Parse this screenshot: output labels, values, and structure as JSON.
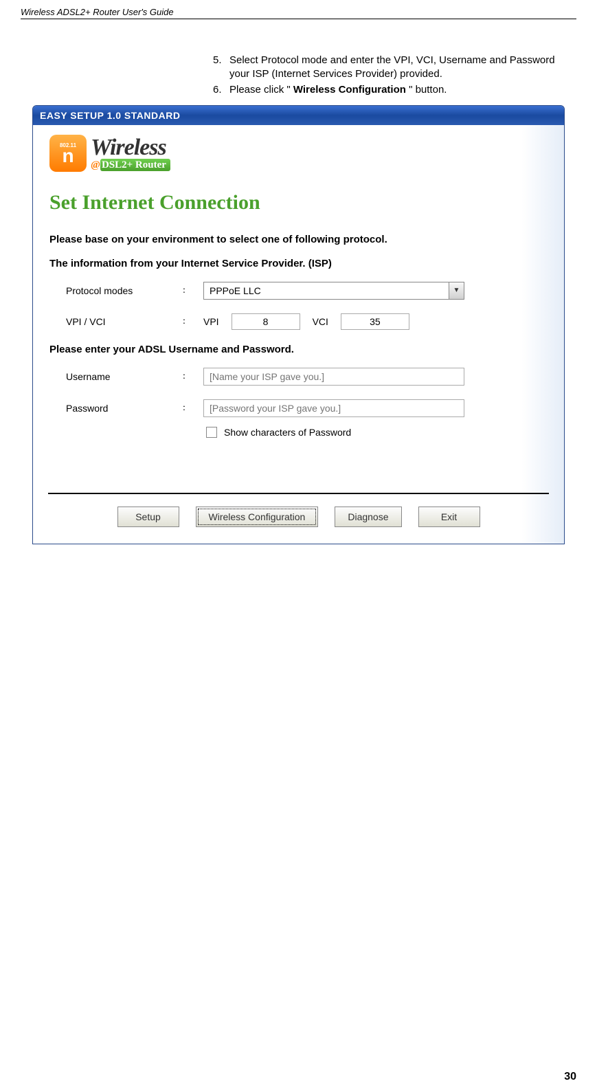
{
  "header": "Wireless ADSL2+ Router User's Guide",
  "instructions": [
    {
      "num": "5.",
      "before": "Select Protocol mode and enter the VPI, VCI, Username and Password your ISP (Internet Services Provider) provided.",
      "bold": "",
      "after": ""
    },
    {
      "num": "6.",
      "before": "Please click \" ",
      "bold": "Wireless Configuration",
      "after": " \" button."
    }
  ],
  "window": {
    "title": "EASY SETUP 1.0 STANDARD",
    "logo": {
      "badge_top": "802.11",
      "badge_letter": "n",
      "wireless": "Wireless",
      "sub_at": "@",
      "sub_rest": "DSL2+ Router"
    },
    "heading": "Set Internet Connection",
    "sub1": "Please base on your environment to select one of following protocol.",
    "sub2": "The information from your Internet Service Provider. (ISP)",
    "protocol": {
      "label": "Protocol modes",
      "value": "PPPoE LLC"
    },
    "vpivci": {
      "label": "VPI / VCI",
      "vpi_label": "VPI",
      "vpi_value": "8",
      "vci_label": "VCI",
      "vci_value": "35"
    },
    "sub3": "Please enter your ADSL Username and Password.",
    "username": {
      "label": "Username",
      "placeholder": "[Name your ISP gave you.]"
    },
    "password": {
      "label": "Password",
      "placeholder": "[Password your ISP gave you.]"
    },
    "showpw": "Show characters of Password",
    "buttons": {
      "setup": "Setup",
      "wireless": "Wireless Configuration",
      "diagnose": "Diagnose",
      "exit": "Exit"
    }
  },
  "page_num": "30"
}
